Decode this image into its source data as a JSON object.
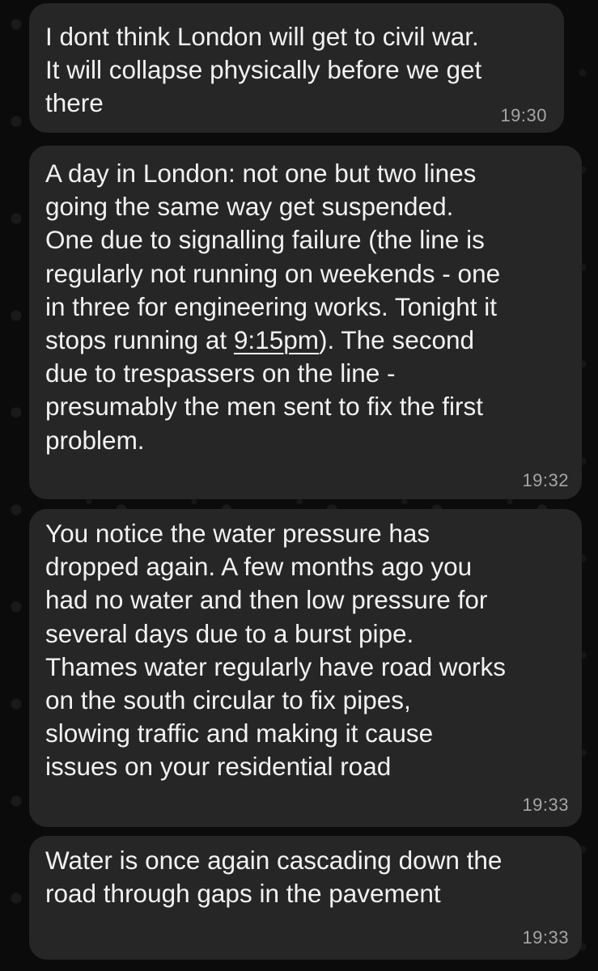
{
  "messages": [
    {
      "text": "I dont think London will get to civil war.\nIt will collapse physically before we get\nthere",
      "time": "19:30"
    },
    {
      "text_before_link": "A day in London: not one but two lines\ngoing the same way get suspended.\nOne due to signalling failure (the line is\nregularly not running on weekends - one\nin three for engineering works. Tonight it\nstops running at ",
      "link": "9:15pm",
      "text_after_link": "). The second\ndue to trespassers on the line -\npresumably the men sent to fix the first\nproblem.",
      "time": "19:32"
    },
    {
      "text": "You notice the water pressure has\ndropped again. A few months ago you\nhad no water and then low pressure for\nseveral days due to a burst pipe.\nThames water regularly have road works\non the south circular to fix pipes,\nslowing traffic and making it cause\nissues on your residential road",
      "time": "19:33"
    },
    {
      "text": "Water is once again cascading down the\nroad through gaps in the pavement",
      "time": "19:33"
    }
  ],
  "colors": {
    "background": "#0b0b0b",
    "bubble": "#262626",
    "text": "#f2f2f2",
    "timestamp": "#a6a6a6"
  }
}
